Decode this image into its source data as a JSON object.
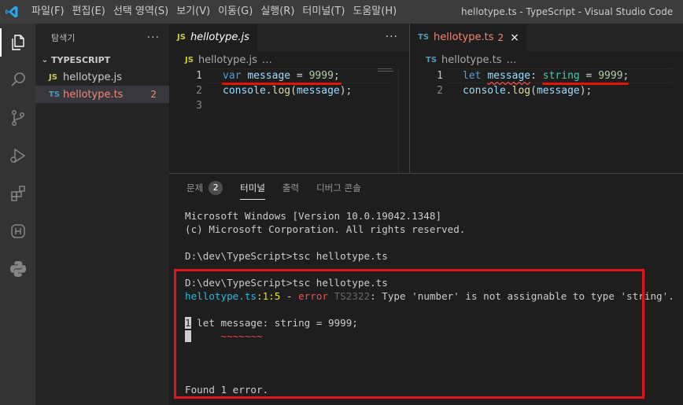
{
  "window": {
    "title": "hellotype.ts - TypeScript - Visual Studio Code",
    "accent": "#007acc"
  },
  "menu": [
    "파일(F)",
    "편집(E)",
    "선택 영역(S)",
    "보기(V)",
    "이동(G)",
    "실행(R)",
    "터미널(T)",
    "도움말(H)"
  ],
  "activitybar": {
    "icons": [
      "explorer-icon",
      "search-icon",
      "source-control-icon",
      "run-debug-icon",
      "extensions-icon",
      "remote-icon",
      "python-icon"
    ]
  },
  "sidebar": {
    "title": "탐색기",
    "more": "···",
    "section": "TYPESCRIPT",
    "files": [
      {
        "icon": "JS",
        "name": "hellotype.js",
        "badge": ""
      },
      {
        "icon": "TS",
        "name": "hellotype.ts",
        "badge": "2"
      }
    ]
  },
  "editor_left": {
    "tab": {
      "icon": "JS",
      "label": "hellotype.js"
    },
    "more": "···",
    "breadcrumb": {
      "icon": "JS",
      "file": "hellotype.js",
      "rest": "…"
    },
    "lines": [
      {
        "num": "1",
        "tokens": [
          [
            "kw",
            "var"
          ],
          [
            "pl",
            " "
          ],
          [
            "vr",
            "message"
          ],
          [
            "pl",
            " = "
          ],
          [
            "nm",
            "9999"
          ],
          [
            "pl",
            ";"
          ]
        ]
      },
      {
        "num": "2",
        "tokens": [
          [
            "vr",
            "console"
          ],
          [
            "pl",
            "."
          ],
          [
            "fn",
            "log"
          ],
          [
            "pl",
            "("
          ],
          [
            "vr",
            "message"
          ],
          [
            "pl",
            ");"
          ]
        ]
      },
      {
        "num": "3",
        "tokens": []
      }
    ]
  },
  "editor_right": {
    "tab": {
      "icon": "TS",
      "label": "hellotype.ts",
      "count": "2",
      "close": "×"
    },
    "breadcrumb": {
      "icon": "TS",
      "file": "hellotype.ts",
      "rest": "…"
    },
    "lines": [
      {
        "num": "1",
        "tokens": [
          [
            "kw",
            "let"
          ],
          [
            "pl",
            " "
          ],
          [
            "vr squig",
            "message"
          ],
          [
            "pl",
            ": "
          ],
          [
            "ty",
            "string"
          ],
          [
            "pl",
            " = "
          ],
          [
            "nm",
            "9999"
          ],
          [
            "pl",
            ";"
          ]
        ]
      },
      {
        "num": "2",
        "tokens": [
          [
            "vr",
            "console"
          ],
          [
            "pl",
            "."
          ],
          [
            "fn",
            "log"
          ],
          [
            "pl",
            "("
          ],
          [
            "vr",
            "message"
          ],
          [
            "pl",
            ");"
          ]
        ]
      }
    ]
  },
  "panel": {
    "tabs": [
      {
        "label": "문제",
        "badge": "2"
      },
      {
        "label": "터미널",
        "badge": ""
      },
      {
        "label": "출력",
        "badge": ""
      },
      {
        "label": "디버그 콘솔",
        "badge": ""
      }
    ],
    "active_tab": "터미널"
  },
  "terminal": {
    "banner1": "Microsoft Windows [Version 10.0.19042.1348]",
    "banner2": "(c) Microsoft Corporation. All rights reserved.",
    "cmd1": "D:\\dev\\TypeScript>tsc hellotype.ts",
    "cmd2": "D:\\dev\\TypeScript>tsc hellotype.ts",
    "err_file": "hellotype.ts",
    "err_pos": ":1:5",
    "err_dash": " - ",
    "err_word": "error",
    "err_code": " TS2322",
    "err_msg": ": Type 'number' is not assignable to type 'string'.",
    "src_num": "1",
    "src_line": " let message: string = 9999;",
    "squiggle": "~~~~~~~",
    "found": "Found 1 error."
  }
}
